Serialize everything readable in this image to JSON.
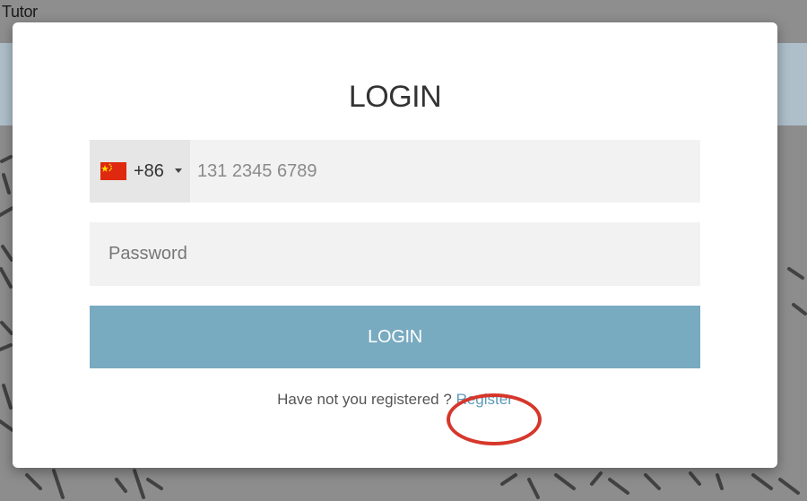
{
  "window": {
    "title": "Tutor"
  },
  "modal": {
    "title": "LOGIN",
    "phone": {
      "country_flag": "china-flag-icon",
      "dial_code": "+86",
      "placeholder": "131 2345 6789",
      "value": ""
    },
    "password": {
      "placeholder": "Password",
      "value": ""
    },
    "login_button_label": "LOGIN",
    "register_prompt": "Have not you registered",
    "register_question_mark": "?",
    "register_link_label": "Register"
  },
  "colors": {
    "accent": "#78aac0",
    "link": "#5a9ab8",
    "annotation_ring": "#d6372b",
    "field_background": "#f2f2f2"
  },
  "annotations": {
    "highlight": "red circle around register-link"
  }
}
